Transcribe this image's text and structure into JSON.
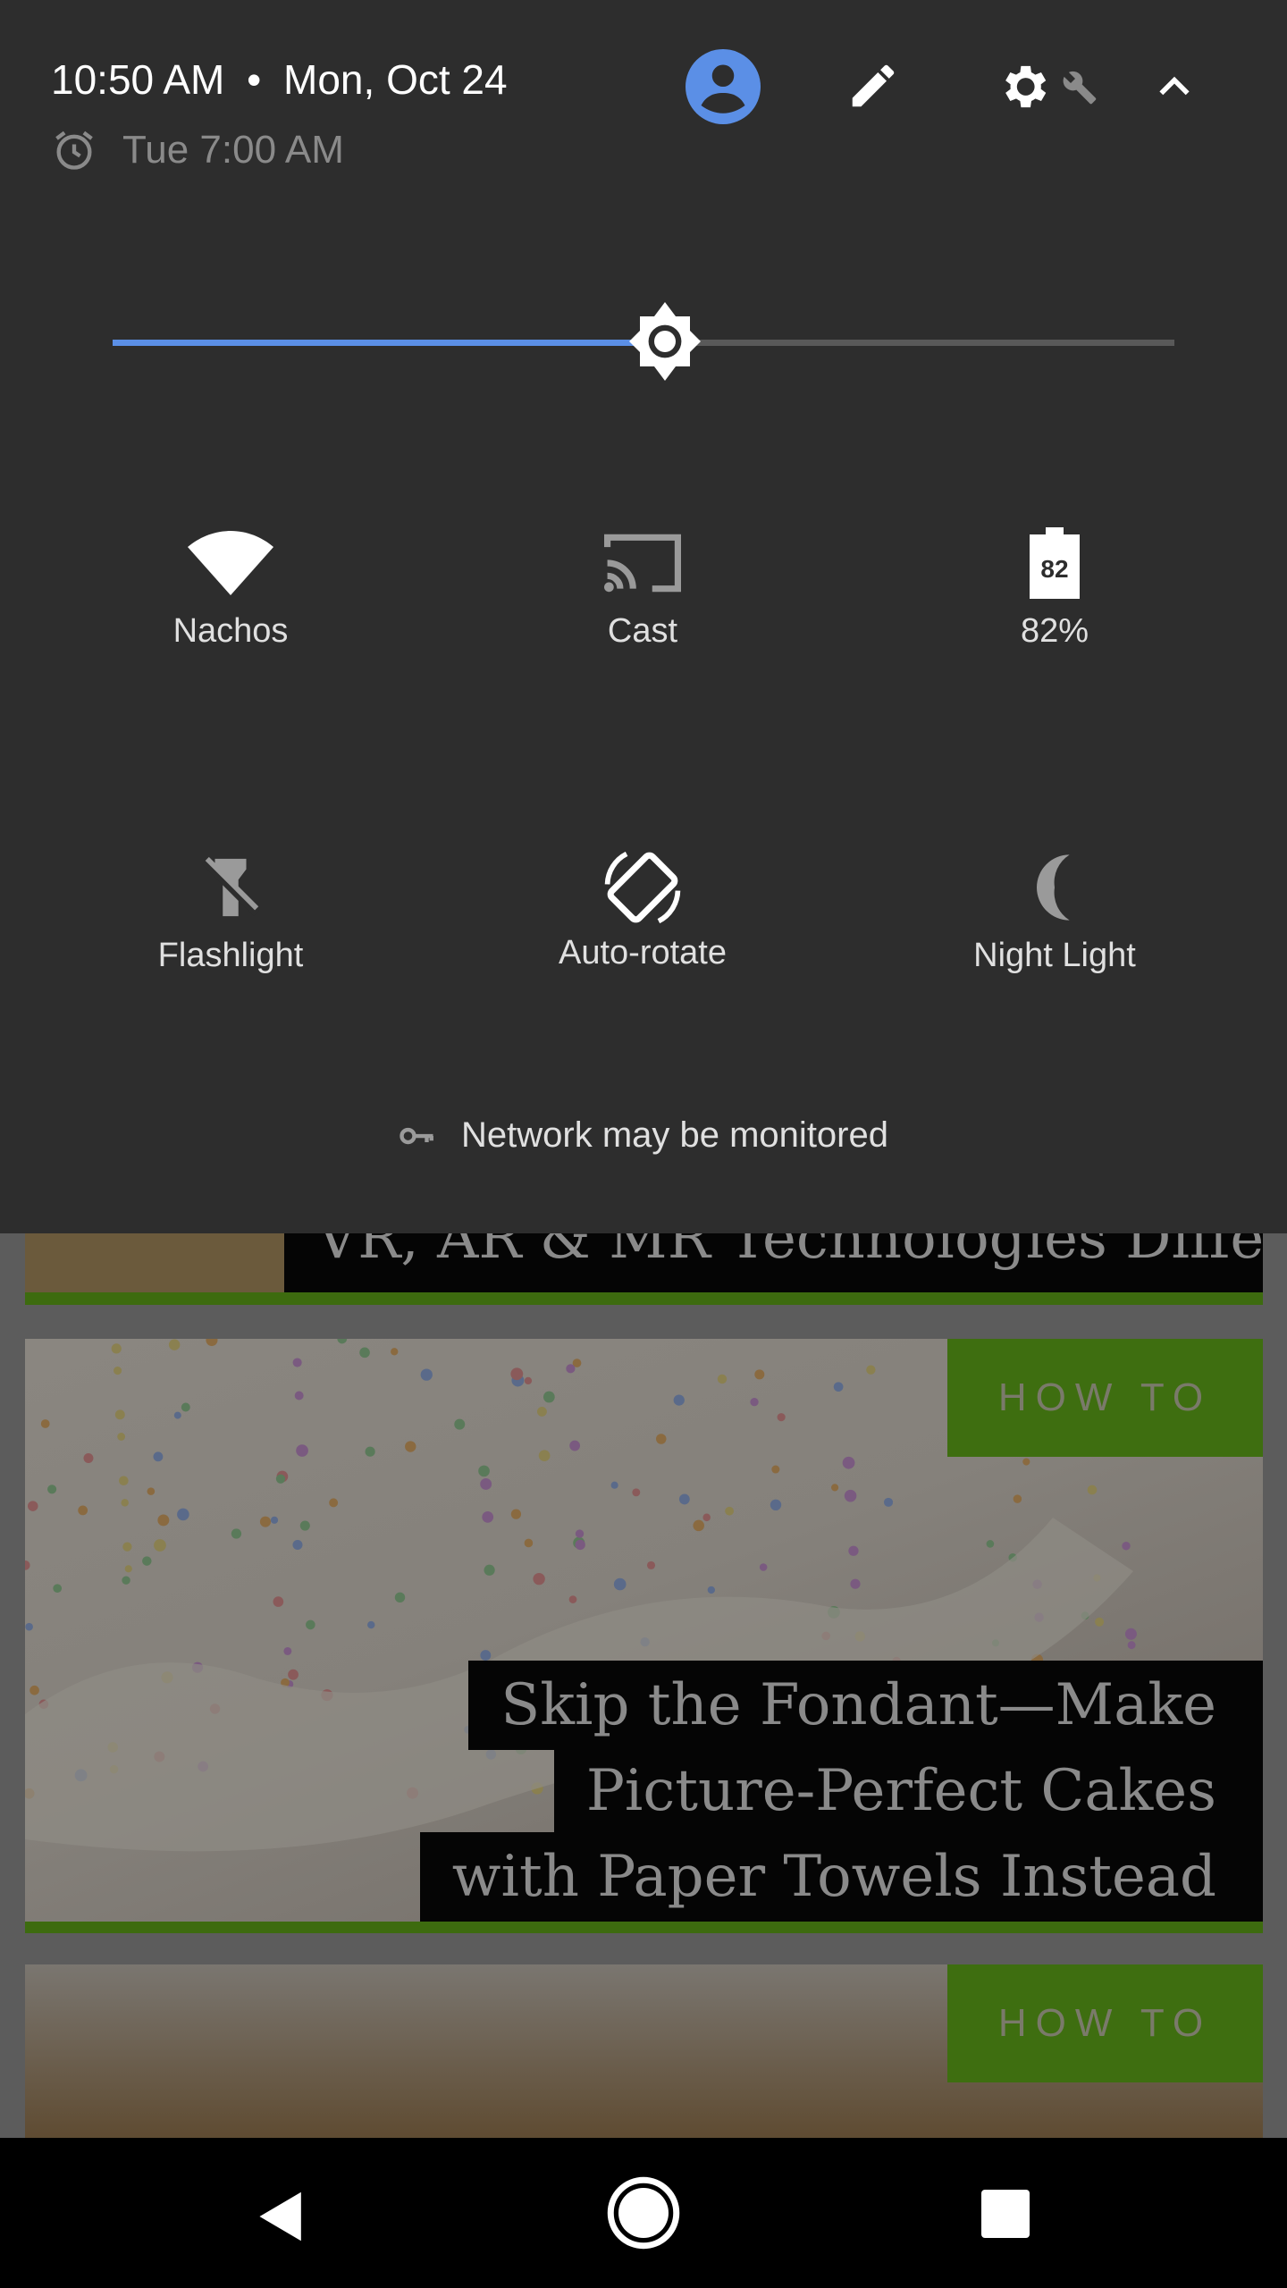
{
  "header": {
    "time": "10:50 AM",
    "separator": "•",
    "date": "Mon, Oct 24",
    "alarm": "Tue 7:00 AM"
  },
  "brightness": {
    "level": 0.52,
    "accent": "#5b8fe6"
  },
  "tiles": [
    {
      "label": "Nachos",
      "icon": "wifi-icon",
      "active": true
    },
    {
      "label": "Cast",
      "icon": "cast-icon",
      "active": false
    },
    {
      "label": "82%",
      "icon": "battery-icon",
      "battery_text": "82",
      "active": true
    },
    {
      "label": "Flashlight",
      "icon": "flashlight-icon",
      "active": false
    },
    {
      "label": "Auto-rotate",
      "icon": "auto-rotate-icon",
      "active": true
    },
    {
      "label": "Night Light",
      "icon": "night-light-icon",
      "active": false
    }
  ],
  "footer": {
    "network": "Network may be monitored"
  },
  "feed": {
    "card1_title": "VR, AR & MR Technologies Differ",
    "card2": {
      "badge": "HOW TO",
      "lines": [
        "Skip the Fondant—Make",
        "Picture-Perfect Cakes",
        "with Paper Towels Instead"
      ]
    },
    "card3": {
      "badge": "HOW TO"
    },
    "accent": "#3e6e10"
  }
}
